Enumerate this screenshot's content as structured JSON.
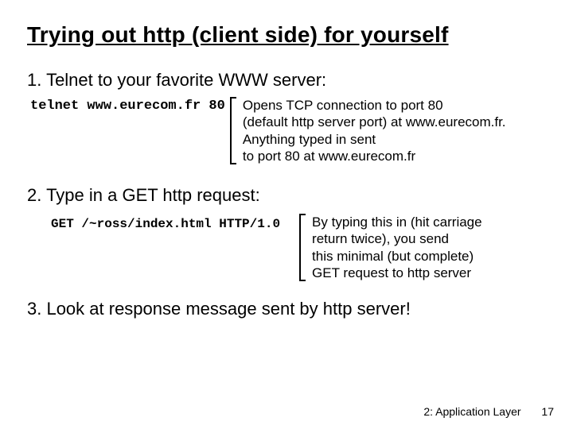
{
  "title": "Trying out http (client side) for yourself",
  "step1": {
    "heading": "1. Telnet to your favorite WWW server:",
    "command": "telnet www.eurecom.fr 80",
    "explain_l1": "Opens TCP connection to port 80",
    "explain_l2": "(default http server port) at www.eurecom.fr.",
    "explain_l3": "Anything typed in sent",
    "explain_l4": "to port 80 at www.eurecom.fr"
  },
  "step2": {
    "heading": "2. Type in a GET http request:",
    "command": "GET /~ross/index.html HTTP/1.0",
    "explain_l1": "By typing this in (hit carriage",
    "explain_l2": "return twice), you send",
    "explain_l3": "this minimal (but complete)",
    "explain_l4": "GET request to http server"
  },
  "step3": {
    "heading": "3. Look at response message sent by http server!"
  },
  "footer": {
    "chapter": "2: Application Layer",
    "page": "17"
  }
}
